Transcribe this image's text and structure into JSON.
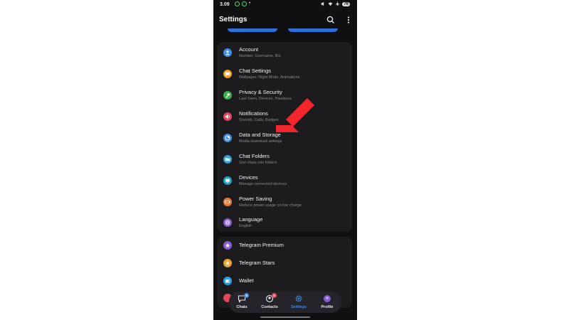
{
  "status_bar": {
    "time": "3.09",
    "battery": "76"
  },
  "app_bar": {
    "title": "Settings",
    "search_icon": "search-icon",
    "more_icon": "more-vertical-icon"
  },
  "settings": [
    {
      "label": "Account",
      "subtitle": "Number, Username, Bio",
      "color": "#3a8ee6",
      "icon": "person-icon"
    },
    {
      "label": "Chat Settings",
      "subtitle": "Wallpaper, Night Mode, Animations",
      "color": "#f0a030",
      "icon": "chat-bubble-icon"
    },
    {
      "label": "Privacy & Security",
      "subtitle": "Last Seen, Devices, Passkeys",
      "color": "#3bb04a",
      "icon": "key-icon"
    },
    {
      "label": "Notifications",
      "subtitle": "Sounds, Calls, Badges",
      "color": "#e8435a",
      "icon": "speaker-icon"
    },
    {
      "label": "Data and Storage",
      "subtitle": "Media download settings",
      "color": "#3a8ee6",
      "icon": "pie-chart-icon"
    },
    {
      "label": "Chat Folders",
      "subtitle": "Sort chats into folders",
      "color": "#2aa0e8",
      "icon": "folder-icon"
    },
    {
      "label": "Devices",
      "subtitle": "Manage connected devices",
      "color": "#1fa3c8",
      "icon": "device-icon"
    },
    {
      "label": "Power Saving",
      "subtitle": "Reduce power usage on low charge",
      "color": "#f07a30",
      "icon": "battery-icon"
    },
    {
      "label": "Language",
      "subtitle": "English",
      "color": "#8a5ad8",
      "icon": "globe-icon"
    }
  ],
  "extras": [
    {
      "label": "Telegram Premium",
      "color": "#8a5ad8",
      "icon": "star-icon"
    },
    {
      "label": "Telegram Stars",
      "color": "#f0a030",
      "icon": "star-icon"
    },
    {
      "label": "Wallet",
      "color": "#2aa0e8",
      "icon": "wallet-icon"
    }
  ],
  "nav": {
    "chats": {
      "label": "Chats",
      "badge": "5"
    },
    "contacts": {
      "label": "Contacts",
      "badge": "8"
    },
    "settings": {
      "label": "Settings"
    },
    "profile": {
      "label": "Profile"
    }
  },
  "colors": {
    "accent": "#3a8ee6",
    "arrow": "#f2262c",
    "background": "#101012",
    "card": "#1c1c1f"
  }
}
